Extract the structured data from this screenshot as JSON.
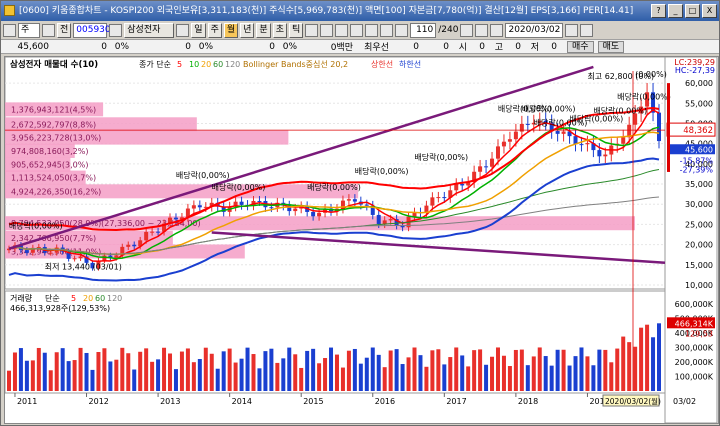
{
  "window": {
    "title": "[0600] 키움종합차트 - KOSPI200 외국인보유[3,311,183(천)] 주식수[5,969,783(천)] 액면[100] 자본금[7,780(억)] 결산[12월] EPS[3,166] PER[14.41]",
    "buttons": [
      "?",
      "_",
      "□",
      "X"
    ]
  },
  "toolbar": {
    "period_label": "주",
    "market_label": "전",
    "code": "005930",
    "stock_name": "삼성전자",
    "intervals": [
      "일",
      "주",
      "월",
      "년",
      "분",
      "초",
      "틱"
    ],
    "active_interval": "월",
    "count": "110",
    "count_total": "/240",
    "date": "2020/03/02"
  },
  "row2": {
    "price": "45,600",
    "v1": "0",
    "pct1": "0%",
    "v2": "0",
    "pct2": "0%",
    "v3": "0",
    "pct3": "0%",
    "label_baekman": "0백만",
    "label_choe": "최우선",
    "v4": "0",
    "v5": "0",
    "label_si": "시",
    "v6": "0",
    "label_go": "고",
    "v7": "0",
    "label_jeo": "저",
    "v8": "0",
    "buy": "매수",
    "sell": "매도"
  },
  "legend": {
    "name": "삼성전자 매물대 수(10)",
    "ma_label": "종가 단순",
    "ma_periods": [
      "5",
      "10",
      "20",
      "60",
      "120"
    ],
    "bb_label": "Bollinger Bands중심선 20,2",
    "upper": "상한선",
    "lower": "하한선"
  },
  "volume_profile": [
    {
      "label": "1,376,943,121(4,5%)",
      "price": 53500,
      "pct": 4.5
    },
    {
      "label": "2,672,592,797(8,8%)",
      "price": 49800,
      "pct": 8.8
    },
    {
      "label": "3,956,223,728(13,0%)",
      "price": 46500,
      "pct": 13.0
    },
    {
      "label": "974,808,160(3,2%)",
      "price": 43200,
      "pct": 3.2
    },
    {
      "label": "905,652,945(3,0%)",
      "price": 39800,
      "pct": 3.0
    },
    {
      "label": "1,113,524,050(3,7%)",
      "price": 36600,
      "pct": 3.7
    },
    {
      "label": "4,924,226,350(16,2%)",
      "price": 33200,
      "pct": 16.2
    },
    {
      "label": "8,794,533,050(28,9%)(27,336,00 ~ 23,184,00)",
      "price": 25300,
      "pct": 28.9
    },
    {
      "label": "2,342,766,950(7,7%)",
      "price": 21700,
      "pct": 7.7
    },
    {
      "label": "3,342,946,300(11,0%)",
      "price": 18300,
      "pct": 11.0
    }
  ],
  "annotations": {
    "high": "최고 62,800 (0%)",
    "high2": "(0,00%)",
    "low": "최저 13,440 (03/01)",
    "dividend": "배당락(0,00%)"
  },
  "price_axis": {
    "ticks": [
      "60,000",
      "55,000",
      "50,000",
      "45,000",
      "40,000",
      "35,000",
      "30,000",
      "25,000",
      "20,000",
      "15,000",
      "10,000"
    ],
    "lc": "LC:239,29",
    "hc": "HC:-27,39",
    "current": "48,362",
    "current2": "45,600",
    "current_pct": "-15,87%",
    "current_pct2": "-27,39%"
  },
  "volume_panel": {
    "title": "거래량",
    "ma_label": "단순",
    "ma_periods": [
      "5",
      "20",
      "60",
      "120"
    ],
    "value": "466,313,928주(129,53%)",
    "axis_value": "466,314K",
    "axis_pct": "129,53",
    "ticks": [
      "600,000K",
      "500,000K",
      "400,000K",
      "300,000K",
      "200,000K",
      "100,000K"
    ]
  },
  "time_axis": {
    "labels": [
      "2011",
      "2012",
      "2013",
      "2014",
      "2015",
      "2016",
      "2017",
      "2018",
      "2019"
    ],
    "current_date": "2020/03/02(월)",
    "end_label": "03/02"
  },
  "colors": {
    "up": "#e8302b",
    "down": "#1a3fd0",
    "ma5": "#ff0000",
    "ma10": "#00b000",
    "ma20": "#f0a000",
    "ma60": "#2a8a2a",
    "ma120": "#808080",
    "bb_mid": "#b07000",
    "bb_upper": "#7a1a7a",
    "bb_lower": "#1a3fd0",
    "profile": "#f59ec6"
  }
}
